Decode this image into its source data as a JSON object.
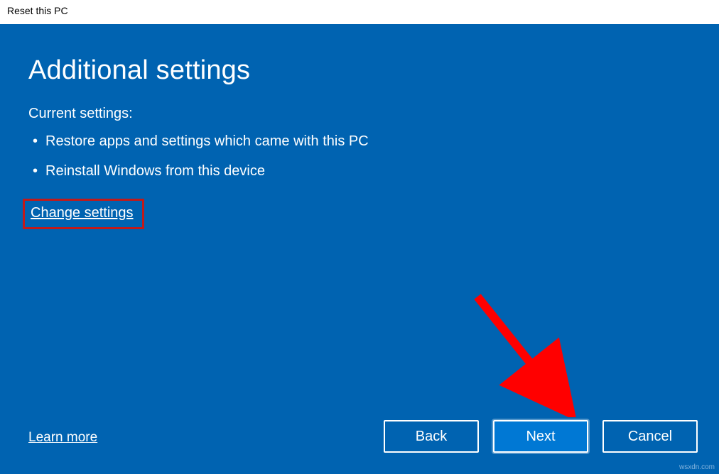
{
  "window": {
    "title": "Reset this PC"
  },
  "main": {
    "heading": "Additional settings",
    "current_settings_label": "Current settings:",
    "bullets": [
      "Restore apps and settings which came with this PC",
      "Reinstall Windows from this device"
    ],
    "change_settings_link": "Change settings",
    "learn_more_link": "Learn more"
  },
  "buttons": {
    "back": "Back",
    "next": "Next",
    "cancel": "Cancel"
  },
  "watermark": "wsxdn.com"
}
